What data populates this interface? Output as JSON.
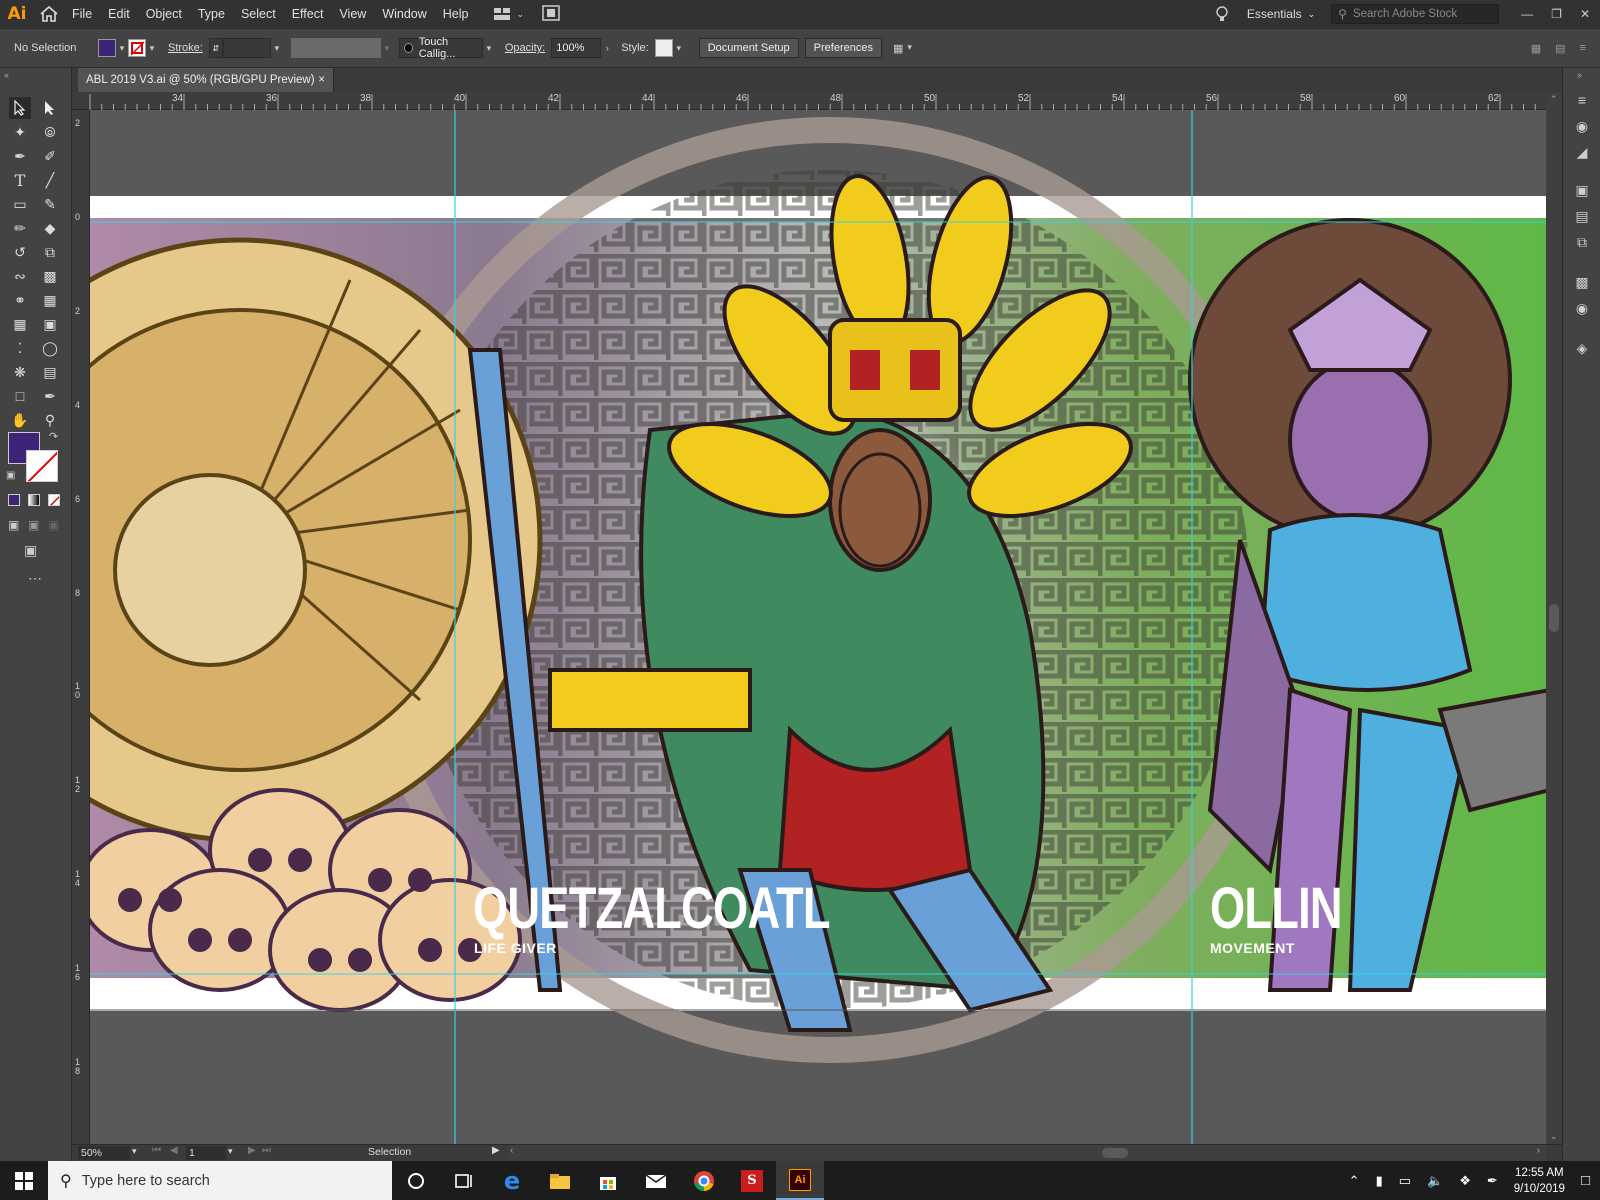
{
  "app": {
    "logo": "Ai"
  },
  "menu": [
    "File",
    "Edit",
    "Object",
    "Type",
    "Select",
    "Effect",
    "View",
    "Window",
    "Help"
  ],
  "workspace": "Essentials",
  "search": {
    "placeholder": "Search Adobe Stock"
  },
  "control": {
    "selection": "No Selection",
    "stroke_label": "Stroke:",
    "brush": "Touch Callig...",
    "opacity_label": "Opacity:",
    "opacity": "100%",
    "style_label": "Style:",
    "doc_setup": "Document Setup",
    "preferences": "Preferences",
    "fill_color": "#3d2478"
  },
  "tab": {
    "title": "ABL 2019 V3.ai @ 50% (RGB/GPU Preview)",
    "close": "×"
  },
  "ruler_top": [
    "34",
    "36",
    "38",
    "40",
    "42",
    "44",
    "46",
    "48",
    "50",
    "52",
    "54",
    "56",
    "58",
    "60",
    "62"
  ],
  "ruler_left": [
    "2",
    "0",
    "2",
    "4",
    "6",
    "8",
    "10",
    "12",
    "14",
    "16",
    "18"
  ],
  "status": {
    "zoom": "50%",
    "artboard": "1",
    "tool": "Selection"
  },
  "artwork": {
    "title1": "QUETZALCOATL",
    "subtitle1": "LIFE GIVER",
    "title2": "OLLIN",
    "subtitle2": "MOVEMENT"
  },
  "taskbar": {
    "search_placeholder": "Type here to search",
    "time": "12:55 AM",
    "date": "9/10/2019"
  },
  "icons": [
    "home-icon",
    "workspace-switcher-icon",
    "lightbulb-icon",
    "search-icon",
    "selection-tool-icon",
    "direct-selection-tool-icon",
    "magic-wand-icon",
    "lasso-icon",
    "pen-tool-icon",
    "type-tool-icon",
    "line-tool-icon",
    "rectangle-tool-icon",
    "paintbrush-icon",
    "eraser-icon",
    "rotate-icon",
    "scale-icon",
    "hand-tool-icon",
    "zoom-tool-icon",
    "windows-start-icon",
    "cortana-icon",
    "task-view-icon",
    "edge-icon",
    "file-explorer-icon",
    "store-icon",
    "mail-icon",
    "chrome-icon",
    "illustrator-icon"
  ]
}
